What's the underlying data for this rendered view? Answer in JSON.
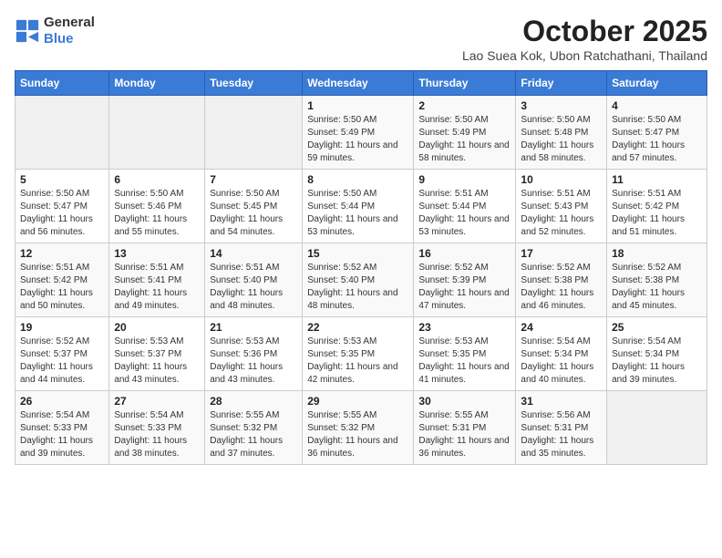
{
  "logo": {
    "general": "General",
    "blue": "Blue"
  },
  "title": "October 2025",
  "subtitle": "Lao Suea Kok, Ubon Ratchathani, Thailand",
  "headers": [
    "Sunday",
    "Monday",
    "Tuesday",
    "Wednesday",
    "Thursday",
    "Friday",
    "Saturday"
  ],
  "rows": [
    [
      {
        "day": "",
        "info": ""
      },
      {
        "day": "",
        "info": ""
      },
      {
        "day": "",
        "info": ""
      },
      {
        "day": "1",
        "info": "Sunrise: 5:50 AM\nSunset: 5:49 PM\nDaylight: 11 hours and 59 minutes."
      },
      {
        "day": "2",
        "info": "Sunrise: 5:50 AM\nSunset: 5:49 PM\nDaylight: 11 hours and 58 minutes."
      },
      {
        "day": "3",
        "info": "Sunrise: 5:50 AM\nSunset: 5:48 PM\nDaylight: 11 hours and 58 minutes."
      },
      {
        "day": "4",
        "info": "Sunrise: 5:50 AM\nSunset: 5:47 PM\nDaylight: 11 hours and 57 minutes."
      }
    ],
    [
      {
        "day": "5",
        "info": "Sunrise: 5:50 AM\nSunset: 5:47 PM\nDaylight: 11 hours and 56 minutes."
      },
      {
        "day": "6",
        "info": "Sunrise: 5:50 AM\nSunset: 5:46 PM\nDaylight: 11 hours and 55 minutes."
      },
      {
        "day": "7",
        "info": "Sunrise: 5:50 AM\nSunset: 5:45 PM\nDaylight: 11 hours and 54 minutes."
      },
      {
        "day": "8",
        "info": "Sunrise: 5:50 AM\nSunset: 5:44 PM\nDaylight: 11 hours and 53 minutes."
      },
      {
        "day": "9",
        "info": "Sunrise: 5:51 AM\nSunset: 5:44 PM\nDaylight: 11 hours and 53 minutes."
      },
      {
        "day": "10",
        "info": "Sunrise: 5:51 AM\nSunset: 5:43 PM\nDaylight: 11 hours and 52 minutes."
      },
      {
        "day": "11",
        "info": "Sunrise: 5:51 AM\nSunset: 5:42 PM\nDaylight: 11 hours and 51 minutes."
      }
    ],
    [
      {
        "day": "12",
        "info": "Sunrise: 5:51 AM\nSunset: 5:42 PM\nDaylight: 11 hours and 50 minutes."
      },
      {
        "day": "13",
        "info": "Sunrise: 5:51 AM\nSunset: 5:41 PM\nDaylight: 11 hours and 49 minutes."
      },
      {
        "day": "14",
        "info": "Sunrise: 5:51 AM\nSunset: 5:40 PM\nDaylight: 11 hours and 48 minutes."
      },
      {
        "day": "15",
        "info": "Sunrise: 5:52 AM\nSunset: 5:40 PM\nDaylight: 11 hours and 48 minutes."
      },
      {
        "day": "16",
        "info": "Sunrise: 5:52 AM\nSunset: 5:39 PM\nDaylight: 11 hours and 47 minutes."
      },
      {
        "day": "17",
        "info": "Sunrise: 5:52 AM\nSunset: 5:38 PM\nDaylight: 11 hours and 46 minutes."
      },
      {
        "day": "18",
        "info": "Sunrise: 5:52 AM\nSunset: 5:38 PM\nDaylight: 11 hours and 45 minutes."
      }
    ],
    [
      {
        "day": "19",
        "info": "Sunrise: 5:52 AM\nSunset: 5:37 PM\nDaylight: 11 hours and 44 minutes."
      },
      {
        "day": "20",
        "info": "Sunrise: 5:53 AM\nSunset: 5:37 PM\nDaylight: 11 hours and 43 minutes."
      },
      {
        "day": "21",
        "info": "Sunrise: 5:53 AM\nSunset: 5:36 PM\nDaylight: 11 hours and 43 minutes."
      },
      {
        "day": "22",
        "info": "Sunrise: 5:53 AM\nSunset: 5:35 PM\nDaylight: 11 hours and 42 minutes."
      },
      {
        "day": "23",
        "info": "Sunrise: 5:53 AM\nSunset: 5:35 PM\nDaylight: 11 hours and 41 minutes."
      },
      {
        "day": "24",
        "info": "Sunrise: 5:54 AM\nSunset: 5:34 PM\nDaylight: 11 hours and 40 minutes."
      },
      {
        "day": "25",
        "info": "Sunrise: 5:54 AM\nSunset: 5:34 PM\nDaylight: 11 hours and 39 minutes."
      }
    ],
    [
      {
        "day": "26",
        "info": "Sunrise: 5:54 AM\nSunset: 5:33 PM\nDaylight: 11 hours and 39 minutes."
      },
      {
        "day": "27",
        "info": "Sunrise: 5:54 AM\nSunset: 5:33 PM\nDaylight: 11 hours and 38 minutes."
      },
      {
        "day": "28",
        "info": "Sunrise: 5:55 AM\nSunset: 5:32 PM\nDaylight: 11 hours and 37 minutes."
      },
      {
        "day": "29",
        "info": "Sunrise: 5:55 AM\nSunset: 5:32 PM\nDaylight: 11 hours and 36 minutes."
      },
      {
        "day": "30",
        "info": "Sunrise: 5:55 AM\nSunset: 5:31 PM\nDaylight: 11 hours and 36 minutes."
      },
      {
        "day": "31",
        "info": "Sunrise: 5:56 AM\nSunset: 5:31 PM\nDaylight: 11 hours and 35 minutes."
      },
      {
        "day": "",
        "info": ""
      }
    ]
  ]
}
